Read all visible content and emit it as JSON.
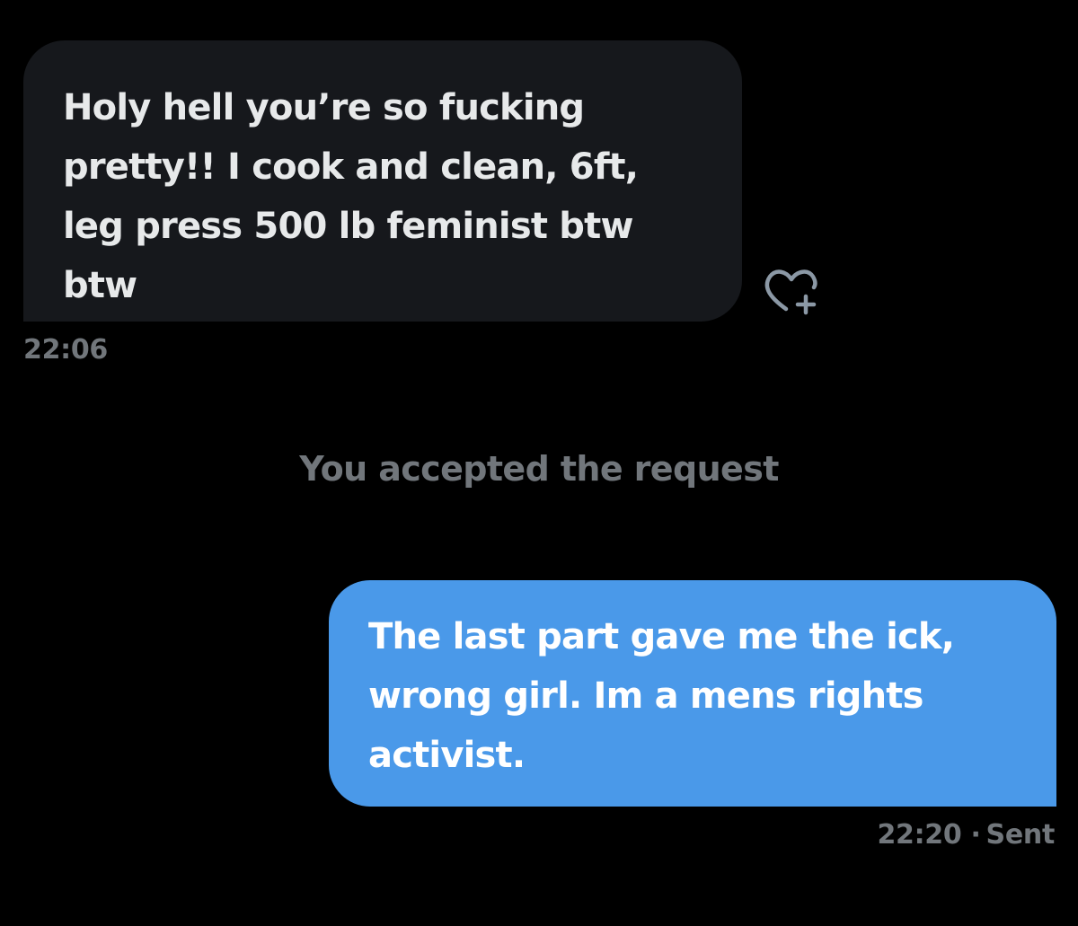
{
  "conversation": {
    "received": {
      "text": "Holy hell you’re so fucking\npretty!! I cook and clean, 6ft,\nleg press 500 lb feminist btw\nbtw",
      "time": "22:06",
      "react_icon": "heart-plus-icon"
    },
    "system_note": "You accepted the request",
    "sent": {
      "text": "The last part gave me the ick,\nwrong girl. Im a mens rights\nactivist.",
      "time": "22:20",
      "separator": "·",
      "status": "Sent"
    }
  },
  "colors": {
    "background": "#000000",
    "received_bubble": "#16181C",
    "sent_bubble": "#4A99E9",
    "muted_text": "#71767B"
  }
}
